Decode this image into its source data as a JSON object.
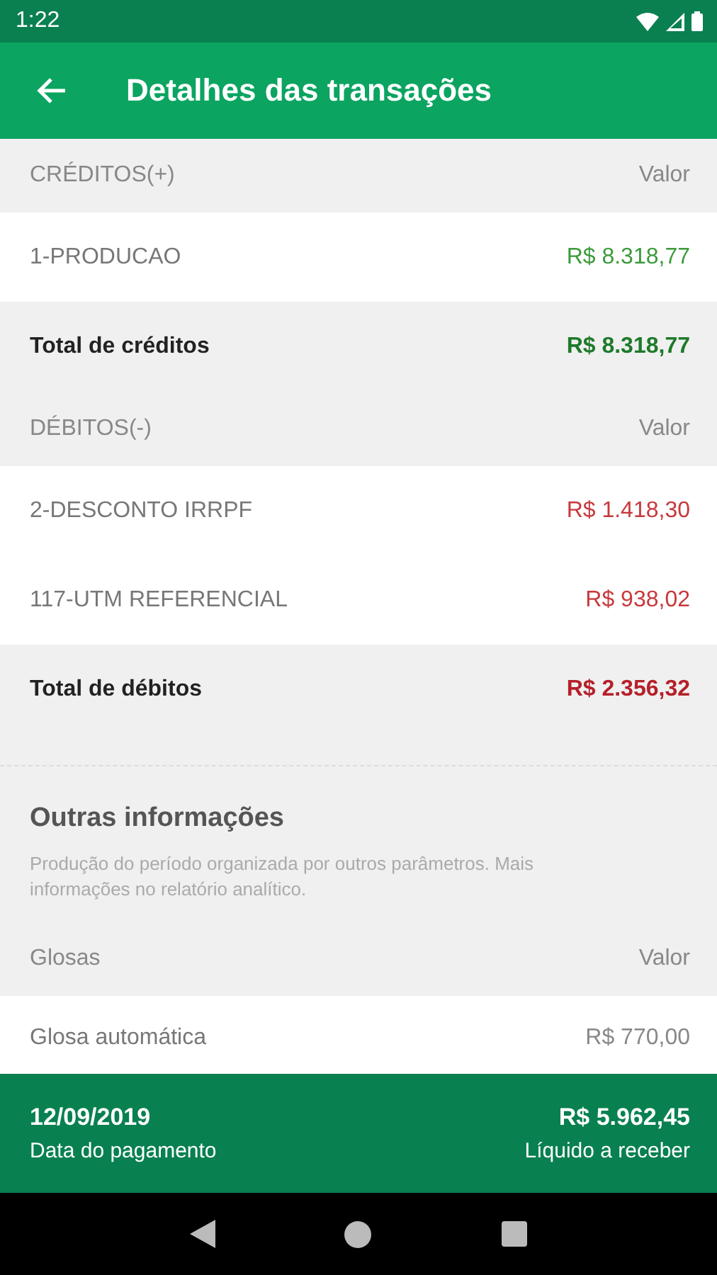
{
  "status_bar": {
    "time": "1:22"
  },
  "app_bar": {
    "title": "Detalhes das transações"
  },
  "sections": [
    {
      "kind": "credit",
      "header": {
        "label": "CRÉDITOS(+)",
        "value_label": "Valor"
      },
      "rows": [
        {
          "label": "1-PRODUCAO",
          "value": "R$ 8.318,77"
        }
      ],
      "total": {
        "label": "Total de créditos",
        "value": "R$ 8.318,77"
      }
    },
    {
      "kind": "debit",
      "header": {
        "label": "DÉBITOS(-)",
        "value_label": "Valor"
      },
      "rows": [
        {
          "label": "2-DESCONTO IRRPF",
          "value": "R$ 1.418,30"
        },
        {
          "label": "117-UTM REFERENCIAL",
          "value": "R$ 938,02"
        }
      ],
      "total": {
        "label": "Total de débitos",
        "value": "R$ 2.356,32"
      }
    }
  ],
  "other_info": {
    "title": "Outras informações",
    "description": "Produção do período organizada por outros parâmetros. Mais informações no relatório analítico.",
    "header": {
      "label": "Glosas",
      "value_label": "Valor"
    },
    "rows": [
      {
        "label": "Glosa automática",
        "value": "R$ 770,00"
      }
    ]
  },
  "footer": {
    "date": "12/09/2019",
    "date_label": "Data do pagamento",
    "amount": "R$ 5.962,45",
    "amount_label": "Líquido a receber"
  }
}
